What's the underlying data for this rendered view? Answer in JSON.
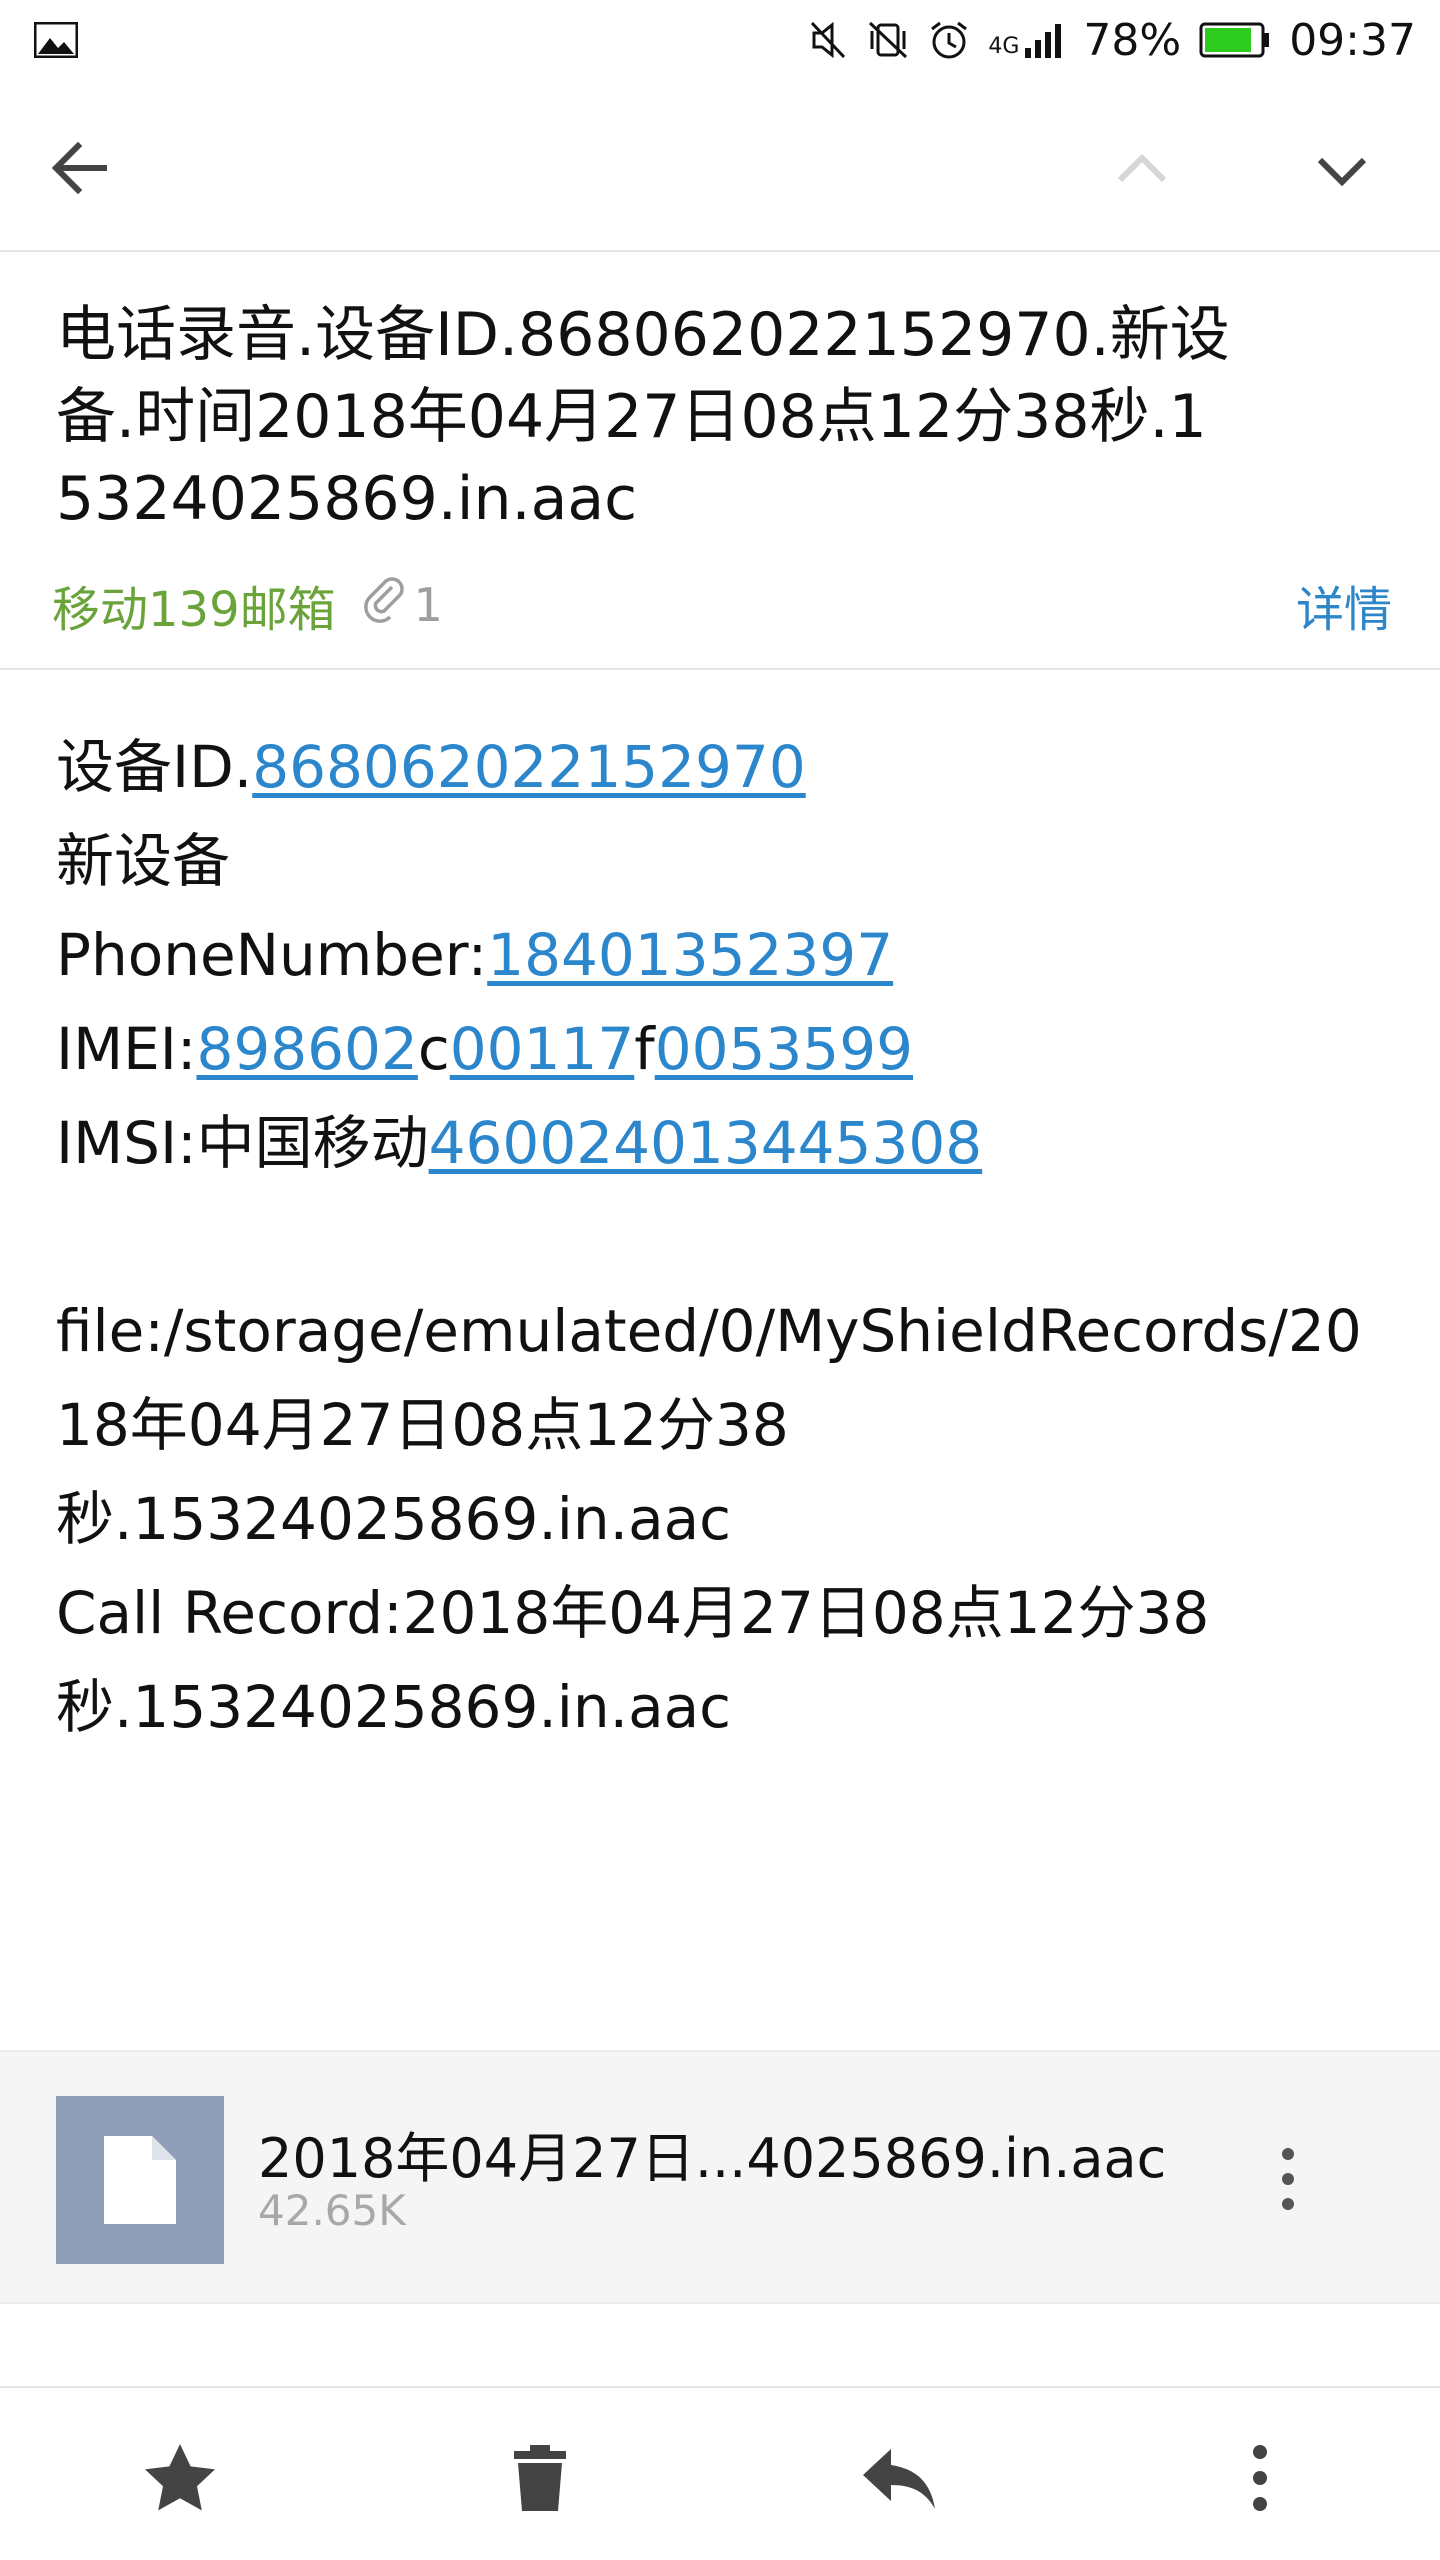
{
  "status_bar": {
    "network": "4G",
    "battery": "78%",
    "time": "09:37",
    "icons": [
      "image-icon",
      "mute-icon",
      "vibrate-off-icon",
      "alarm-icon",
      "signal-icon",
      "battery-icon"
    ]
  },
  "nav": {
    "icons": [
      "back-arrow-icon",
      "chevron-up-icon",
      "chevron-down-icon"
    ]
  },
  "email": {
    "subject": "电话录音.设备ID.868062022152970.新设备.时间2018年04月27日08点12分38秒.15324025869.in.aac",
    "sender": "移动139邮箱",
    "attachment_count": "1",
    "details_label": "详情"
  },
  "body": {
    "device_id_label": "设备ID.",
    "device_id": "868062022152970",
    "new_device": "新设备",
    "phone_label": "PhoneNumber:",
    "phone": "18401352397",
    "imei_label": "IMEI:",
    "imei_part1": "898602",
    "imei_sep1": "c",
    "imei_part2": "00117",
    "imei_sep2": "f",
    "imei_part3": "0053599",
    "imsi_label": "IMSI:中国移动",
    "imsi": "460024013445308",
    "file_line1": "file:/storage/emulated/0/MyShieldRecords/20",
    "file_line2": "18年04月27日08点12分38",
    "file_line3": "秒.15324025869.in.aac",
    "call_line1": "Call Record:2018年04月27日08点12分38",
    "call_line2": "秒.15324025869.in.aac"
  },
  "attachment": {
    "name": "2018年04月27日...4025869.in.aac",
    "size": "42.65K"
  },
  "toolbar": {
    "icons": [
      "star-icon",
      "trash-icon",
      "reply-icon",
      "more-vertical-icon"
    ]
  },
  "colors": {
    "link": "#2b86cc",
    "sender": "#6aa33a",
    "details": "#2d86c7",
    "file_thumb": "#8f9fb9",
    "battery": "#2ecc1f"
  }
}
